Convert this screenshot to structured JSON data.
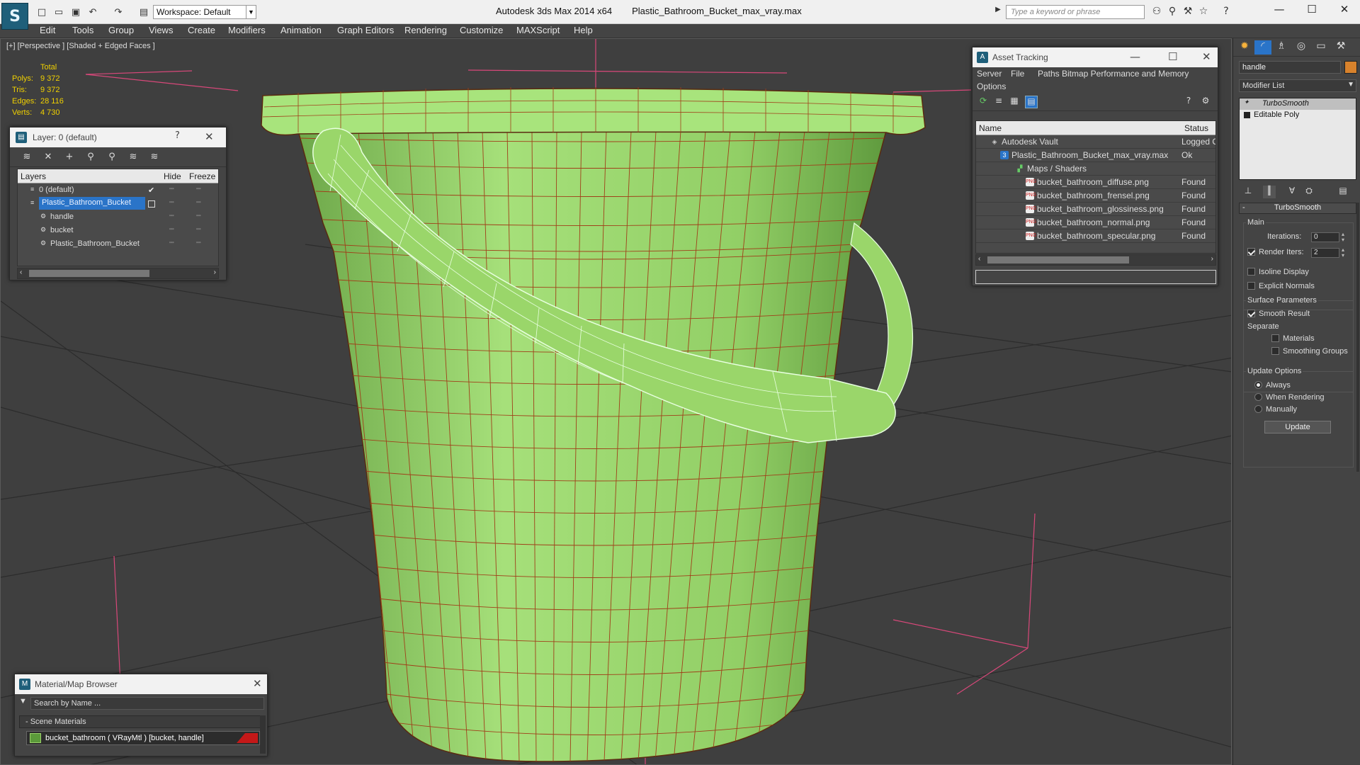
{
  "window": {
    "app_title": "Autodesk 3ds Max  2014 x64",
    "file_title": "Plastic_Bathroom_Bucket_max_vray.max",
    "workspace": "Workspace: Default",
    "search_placeholder": "Type a keyword or phrase"
  },
  "menu": [
    "Edit",
    "Tools",
    "Group",
    "Views",
    "Create",
    "Modifiers",
    "Animation",
    "Graph Editors",
    "Rendering",
    "Customize",
    "MAXScript",
    "Help"
  ],
  "viewport": {
    "label": "[+] [Perspective ] [Shaded + Edged Faces ]",
    "stats_header": "Total",
    "stats": [
      {
        "label": "Polys:",
        "value": "9 372"
      },
      {
        "label": "Tris:",
        "value": "9 372"
      },
      {
        "label": "Edges:",
        "value": "28 116"
      },
      {
        "label": "Verts:",
        "value": "4 730"
      }
    ]
  },
  "layer_panel": {
    "title": "Layer: 0 (default)",
    "help": "?",
    "close": "✕",
    "columns": [
      "Layers",
      "Hide",
      "Freeze"
    ],
    "rows": [
      {
        "name": "0 (default)",
        "indent": 0,
        "active": true,
        "selected": false
      },
      {
        "name": "Plastic_Bathroom_Bucket",
        "indent": 0,
        "active": false,
        "selected": true
      },
      {
        "name": "handle",
        "indent": 1,
        "active": false,
        "selected": false
      },
      {
        "name": "bucket",
        "indent": 1,
        "active": false,
        "selected": false
      },
      {
        "name": "Plastic_Bathroom_Bucket",
        "indent": 1,
        "active": false,
        "selected": false
      }
    ]
  },
  "asset_panel": {
    "title": "Asset Tracking",
    "menus": [
      "Server",
      "File",
      "Paths",
      "Bitmap Performance and Memory",
      "Options"
    ],
    "columns": [
      "Name",
      "Status"
    ],
    "rows": [
      {
        "name": "Autodesk Vault",
        "status": "Logged O",
        "indent": 1,
        "icon": "vault"
      },
      {
        "name": "Plastic_Bathroom_Bucket_max_vray.max",
        "status": "Ok",
        "indent": 2,
        "icon": "max"
      },
      {
        "name": "Maps / Shaders",
        "status": "",
        "indent": 3,
        "icon": "folder"
      },
      {
        "name": "bucket_bathroom_diffuse.png",
        "status": "Found",
        "indent": 4,
        "icon": "png"
      },
      {
        "name": "bucket_bathroom_frensel.png",
        "status": "Found",
        "indent": 4,
        "icon": "png"
      },
      {
        "name": "bucket_bathroom_glossiness.png",
        "status": "Found",
        "indent": 4,
        "icon": "png"
      },
      {
        "name": "bucket_bathroom_normal.png",
        "status": "Found",
        "indent": 4,
        "icon": "png"
      },
      {
        "name": "bucket_bathroom_specular.png",
        "status": "Found",
        "indent": 4,
        "icon": "png"
      }
    ]
  },
  "material_browser": {
    "title": "Material/Map Browser",
    "search_placeholder": "Search by Name ...",
    "group": "- Scene Materials",
    "item": "bucket_bathroom  ( VRayMtl )  [bucket, handle]"
  },
  "command_panel": {
    "object_name": "handle",
    "object_color": "#d8822c",
    "modifier_list": "Modifier List",
    "stack": [
      "TurboSmooth",
      "Editable Poly"
    ],
    "rollout": "TurboSmooth",
    "main_label": "Main",
    "iterations_label": "Iterations:",
    "iterations_value": "0",
    "render_iters_label": "Render Iters:",
    "render_iters_value": "2",
    "render_iters_checked": true,
    "isoline_label": "Isoline Display",
    "isoline_checked": false,
    "explicit_normals_label": "Explicit Normals",
    "explicit_normals_checked": false,
    "surface_params_label": "Surface Parameters",
    "smooth_result_label": "Smooth Result",
    "smooth_result_checked": true,
    "separate_label": "Separate",
    "materials_label": "Materials",
    "materials_checked": false,
    "smoothing_groups_label": "Smoothing Groups",
    "smoothing_groups_checked": false,
    "update_options_label": "Update Options",
    "always_label": "Always",
    "when_rendering_label": "When Rendering",
    "manually_label": "Manually",
    "update_selected": "Always",
    "update_button": "Update"
  },
  "colors": {
    "bucket_green": "#9ad66a",
    "wire_red": "#a0401a",
    "selection_blue": "#2a74c8",
    "stats_yellow": "#f0d000"
  }
}
